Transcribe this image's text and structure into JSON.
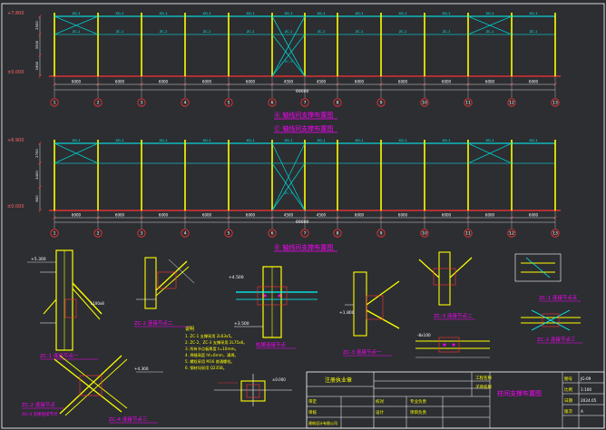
{
  "drawing_title_1": "Ⓐ 轴线间支撑布置图",
  "drawing_title_2": "Ⓒ 轴线间支撑布置图",
  "drawing_title_3": "Ⓑ 轴线间支撑布置图",
  "axis_labels": [
    "1",
    "2",
    "3",
    "4",
    "5",
    "6",
    "7",
    "8",
    "9",
    "10",
    "11",
    "12",
    "13"
  ],
  "frame1": {
    "elev_top": "+7.800",
    "elev_bottom": "±0.000",
    "side_dims": [
      "2500",
      "3500",
      "1800"
    ],
    "bay_dim": "6000",
    "bay_dims": [
      "6000",
      "6000",
      "6000",
      "6000",
      "6000",
      "4500",
      "4500",
      "6000",
      "6000",
      "6000",
      "6000",
      "6000"
    ],
    "total_dim": "69000",
    "top_labels": [
      "XG-1",
      "XG-1",
      "XG-1",
      "XG-1",
      "XG-1",
      "XG-1",
      "XG-1",
      "XG-1",
      "XG-1",
      "XG-1",
      "XG-1",
      "XG-1"
    ],
    "strut_labels": [
      "ZC-1",
      "ZC-1",
      "ZC-1",
      "ZC-1",
      "ZC-1",
      "ZC-1",
      "ZC-1",
      "ZC-1",
      "ZC-1",
      "ZC-1",
      "ZC-1",
      "ZC-1"
    ],
    "brace_label": "ZC-2"
  },
  "frame2": {
    "elev_top": "+6.900",
    "elev_bottom": "±0.000",
    "side_dims": [
      "2700",
      "3400",
      "800"
    ],
    "bay_dims": [
      "6000",
      "6000",
      "6000",
      "6000",
      "6000",
      "4500",
      "4500",
      "6000",
      "6000",
      "6000",
      "6000",
      "6000"
    ],
    "total_dim": "69000",
    "top_labels": [
      "XG-1",
      "XG-1",
      "XG-1",
      "XG-1",
      "XG-1",
      "XG-1",
      "XG-1",
      "XG-1",
      "XG-1",
      "XG-1",
      "XG-1",
      "XG-1"
    ],
    "brace_label": "ZC-3"
  },
  "details": {
    "d1_title": "ZC-1 连接节点一",
    "d2_title": "ZC-2 连接节点二",
    "d3_title": "柱脚连接节点",
    "d4_title": "ZC-3 连接节点一",
    "d5_title": "ZC-3 连接节点二",
    "d6_title": "ZC-4 连接节点三",
    "d7_title": "ZC-2 连接节点三",
    "d8_title": "ZC-3 连接节点四",
    "d9_title": "ZC-2 连接节点",
    "d9_sub": "XG-4 支撑连接节点",
    "d10_title": "ZC-1 连接节点五",
    "elev_a": "+5.300",
    "elev_b": "+4.300",
    "elev_c": "+4.500",
    "elev_d": "+3.500",
    "elev_e": "+1.800",
    "elev_f": "±0.000",
    "sec_a": "L100x8",
    "sec_b": "-8x100"
  },
  "notes": {
    "heading": "说明",
    "lines": [
      "1. ZC-1 支撑采用 2L63x5。",
      "2. ZC-2、ZC-3 支撑采用 2L75x6。",
      "3. 所有节点板厚度 t=10mm。",
      "4. 焊缝高度 hf=6mm，满焊。",
      "5. 螺栓采用 M16 普通螺栓。",
      "6. 钢材均采用 Q235B。"
    ]
  },
  "title_block": {
    "main_title": "柱间支撑布置图",
    "stamp": "注册执业章",
    "project": "工程名称",
    "subitem": "子项名称",
    "row_labels": [
      "审定",
      "审核",
      "校对",
      "设计"
    ],
    "col_labels": [
      "专业负责",
      "项目负责"
    ],
    "right_labels": [
      "图号",
      "比例",
      "日期",
      "版次"
    ],
    "right_values": [
      "JG-09",
      "1:100",
      "2024.05",
      "A"
    ],
    "company": "建筑设计有限公司"
  },
  "colors": {
    "column": "#ffff00",
    "beam": "#00ffff",
    "brace": "#00cccc",
    "dim": "#ff3333",
    "title": "#ff00ff",
    "text": "#ffffff",
    "axis": "#ff3333"
  }
}
